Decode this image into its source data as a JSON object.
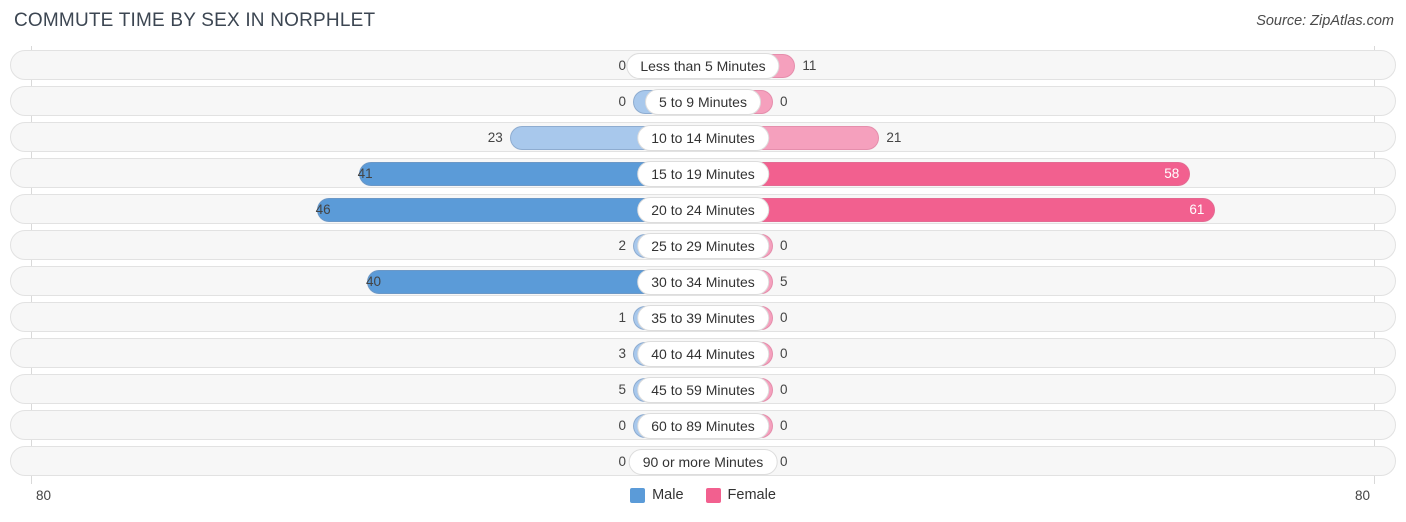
{
  "header": {
    "title": "COMMUTE TIME BY SEX IN NORPHLET",
    "source": "Source: ZipAtlas.com"
  },
  "axis": {
    "left_tick": "80",
    "right_tick": "80"
  },
  "legend": {
    "items": [
      {
        "label": "Male",
        "color": "#5b9bd8"
      },
      {
        "label": "Female",
        "color": "#f2608f"
      }
    ]
  },
  "colors": {
    "male_strong": "#5b9bd8",
    "male_light": "#a8c8ec",
    "female_strong": "#f2608f",
    "female_light": "#f5a0bd",
    "track": "#f7f7f7",
    "track_border": "#e2e2e2",
    "axis": "#d9d9d9"
  },
  "chart_data": {
    "type": "bar",
    "title": "COMMUTE TIME BY SEX IN NORPHLET",
    "subtitle": "Source: ZipAtlas.com",
    "orientation": "horizontal",
    "layout": "diverging-bidirectional",
    "xlabel": "",
    "ylabel": "",
    "xlim": [
      80,
      80
    ],
    "axis_max": 80,
    "grid": false,
    "legend_position": "bottom-center",
    "categories": [
      "Less than 5 Minutes",
      "5 to 9 Minutes",
      "10 to 14 Minutes",
      "15 to 19 Minutes",
      "20 to 24 Minutes",
      "25 to 29 Minutes",
      "30 to 34 Minutes",
      "35 to 39 Minutes",
      "40 to 44 Minutes",
      "45 to 59 Minutes",
      "60 to 89 Minutes",
      "90 or more Minutes"
    ],
    "series": [
      {
        "name": "Male",
        "direction": "left",
        "values": [
          0,
          0,
          23,
          41,
          46,
          2,
          40,
          1,
          3,
          5,
          0,
          0
        ]
      },
      {
        "name": "Female",
        "direction": "right",
        "values": [
          11,
          0,
          21,
          58,
          61,
          0,
          5,
          0,
          0,
          0,
          0,
          0
        ]
      }
    ]
  },
  "rows": [
    {
      "category": "Less than 5 Minutes",
      "male": "0",
      "female": "11"
    },
    {
      "category": "5 to 9 Minutes",
      "male": "0",
      "female": "0"
    },
    {
      "category": "10 to 14 Minutes",
      "male": "23",
      "female": "21"
    },
    {
      "category": "15 to 19 Minutes",
      "male": "41",
      "female": "58"
    },
    {
      "category": "20 to 24 Minutes",
      "male": "46",
      "female": "61"
    },
    {
      "category": "25 to 29 Minutes",
      "male": "2",
      "female": "0"
    },
    {
      "category": "30 to 34 Minutes",
      "male": "40",
      "female": "5"
    },
    {
      "category": "35 to 39 Minutes",
      "male": "1",
      "female": "0"
    },
    {
      "category": "40 to 44 Minutes",
      "male": "3",
      "female": "0"
    },
    {
      "category": "45 to 59 Minutes",
      "male": "5",
      "female": "0"
    },
    {
      "category": "60 to 89 Minutes",
      "male": "0",
      "female": "0"
    },
    {
      "category": "90 or more Minutes",
      "male": "0",
      "female": "0"
    }
  ]
}
